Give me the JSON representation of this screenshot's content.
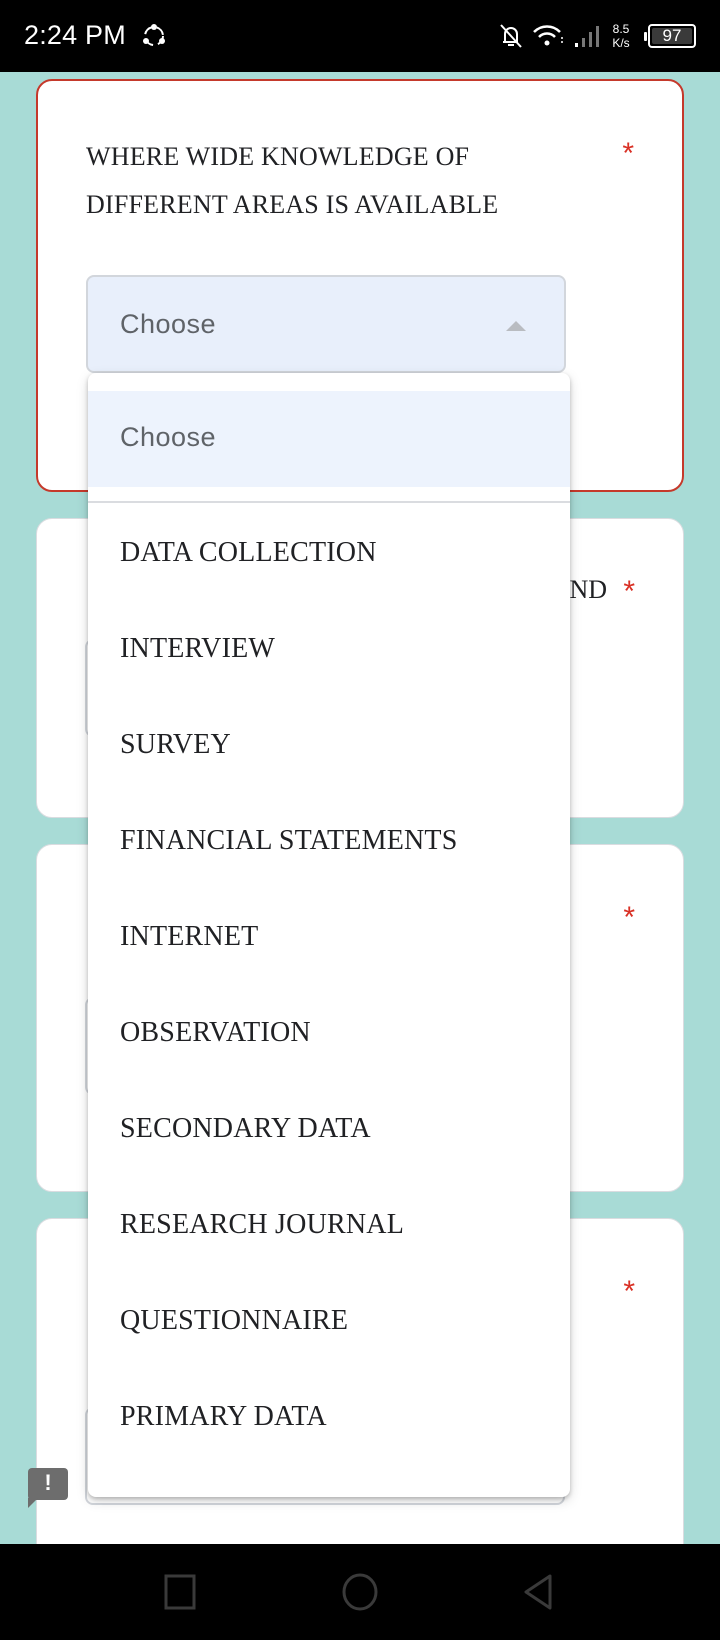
{
  "status_bar": {
    "time": "2:24 PM",
    "app_icon": "sync-share-icon",
    "icons": [
      "notifications-off-icon",
      "wifi-icon",
      "cell-signal-icon"
    ],
    "net_speed_value": "8.5",
    "net_speed_unit": "K/s",
    "battery_percent": "97"
  },
  "form": {
    "questions": [
      {
        "text": "WHERE WIDE KNOWLEDGE OF DIFFERENT AREAS IS AVAILABLE",
        "required_mark": "*",
        "select_value": "Choose",
        "state": "error"
      },
      {
        "partial_text": "ND",
        "required_mark": "*"
      },
      {
        "required_mark": "*"
      },
      {
        "required_mark": "*"
      }
    ]
  },
  "dropdown": {
    "placeholder_option": "Choose",
    "options": [
      "DATA COLLECTION",
      "INTERVIEW",
      "SURVEY",
      "FINANCIAL STATEMENTS",
      "INTERNET",
      "OBSERVATION",
      "SECONDARY DATA",
      "RESEARCH JOURNAL",
      "QUESTIONNAIRE",
      "PRIMARY DATA"
    ]
  },
  "feedback": {
    "mark": "!"
  },
  "nav_bar": {
    "buttons": [
      "recent-apps",
      "home",
      "back"
    ]
  },
  "colors": {
    "background": "#a8dbd6",
    "error_border": "#c5392b",
    "required": "#d93025",
    "select_bg": "#e8effb",
    "highlight_bg": "#edf3fd"
  }
}
